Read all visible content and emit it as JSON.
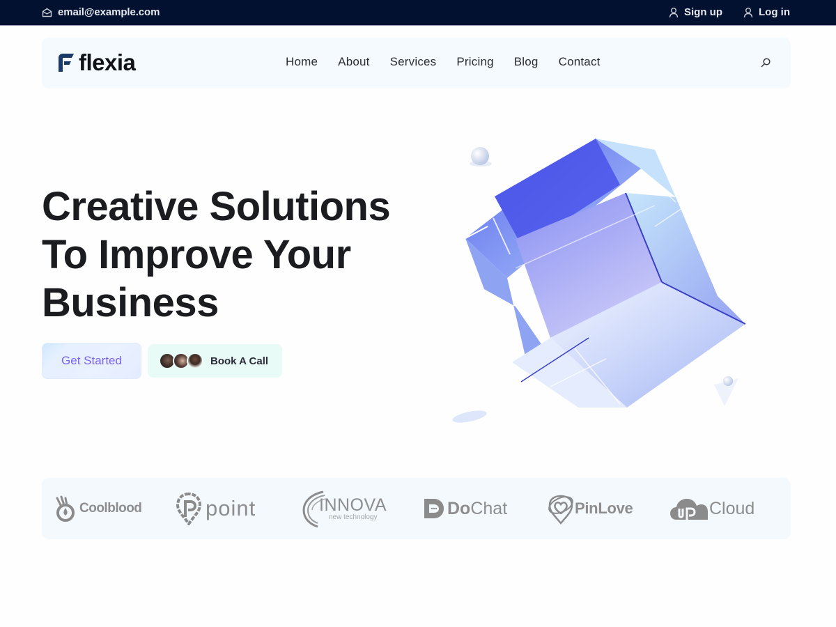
{
  "topbar": {
    "email": "email@example.com",
    "signup": "Sign up",
    "login": "Log in"
  },
  "nav": {
    "brand": "flexia",
    "links": [
      "Home",
      "About",
      "Services",
      "Pricing",
      "Blog",
      "Contact"
    ]
  },
  "hero": {
    "title_lines": [
      "Creative Solutions",
      "To Improve Your",
      "Business"
    ],
    "primary_button": "Get Started",
    "secondary_button": "Book A Call"
  },
  "brands": {
    "coolblood": "Coolblood",
    "point": "point",
    "innova": "INNOVA",
    "innova_sub": "new technology",
    "dochat_bold": "Do",
    "dochat_rest": "Chat",
    "pinlove": "PinLove",
    "upcloud_mark": "up",
    "upcloud": "Cloud"
  },
  "colors": {
    "topbar_bg": "#01112f",
    "nav_bg": "#f5faff",
    "brand_dark": "#1b3a68",
    "accent_purple": "#7a63f0",
    "call_bg": "#e8fbf6",
    "cube_blue": "#4a50e6"
  }
}
